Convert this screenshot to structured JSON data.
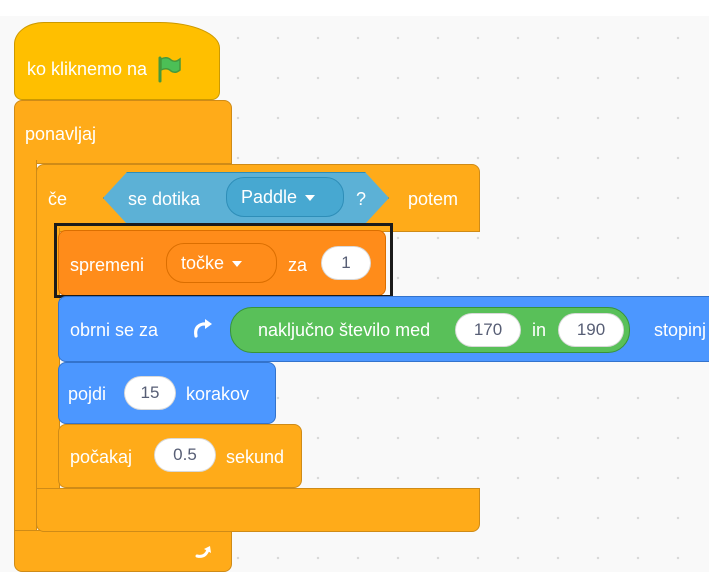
{
  "when_flag": {
    "label": "ko kliknemo na"
  },
  "forever": {
    "label": "ponavljaj"
  },
  "if_block": {
    "if_label": "če",
    "then_label": "potem"
  },
  "touching": {
    "label": "se dotika",
    "target": "Paddle",
    "question": "?"
  },
  "change_var": {
    "label": "spremeni",
    "variable": "točke",
    "by_label": "za",
    "value": "1"
  },
  "turn": {
    "label": "obrni se za",
    "unit_label": "stopinj"
  },
  "random": {
    "label": "naključno število med",
    "from": "170",
    "and_label": "in",
    "to": "190"
  },
  "move": {
    "label": "pojdi",
    "steps": "15",
    "unit_label": "korakov"
  },
  "wait": {
    "label": "počakaj",
    "seconds": "0.5",
    "unit_label": "sekund"
  },
  "colors": {
    "events": "#ffbf00",
    "control": "#ffab19",
    "motion": "#4c97ff",
    "variables": "#ff8c1a",
    "sensing": "#5cb1d6",
    "operators": "#59c059"
  },
  "icons": {
    "flag": "green-flag-icon",
    "turn": "rotate-right-icon",
    "loop": "loop-arrow-icon"
  }
}
